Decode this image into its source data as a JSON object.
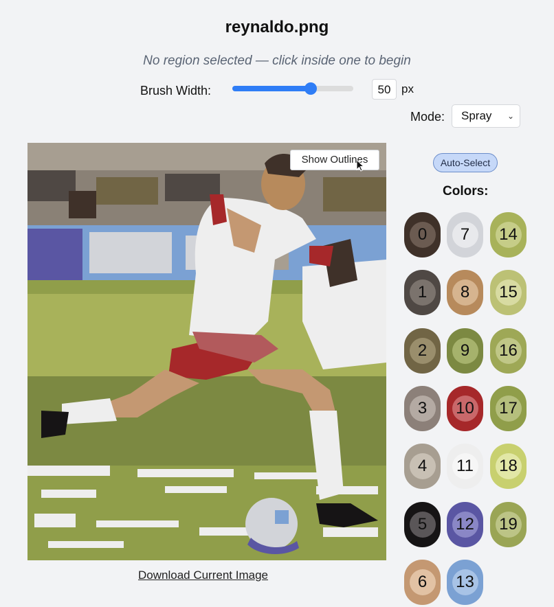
{
  "title": "reynaldo.png",
  "status": "No region selected — click inside one to begin",
  "brush": {
    "label": "Brush Width:",
    "value": "50",
    "unit": "px",
    "fraction": 0.65
  },
  "mode": {
    "label": "Mode:",
    "selected": "Spray"
  },
  "canvas": {
    "show_outlines": "Show Outlines"
  },
  "download_link": "Download Current Image",
  "auto_select": "Auto-Select",
  "colors_label": "Colors:",
  "colors": [
    {
      "n": "0",
      "color": "#3f3129",
      "inner": "#6b5b51"
    },
    {
      "n": "1",
      "color": "#4f4844",
      "inner": "#7b736d"
    },
    {
      "n": "2",
      "color": "#716545",
      "inner": "#9a8e6c"
    },
    {
      "n": "3",
      "color": "#8c8079",
      "inner": "#b4aaa3"
    },
    {
      "n": "4",
      "color": "#a79e91",
      "inner": "#c8c0b4"
    },
    {
      "n": "5",
      "color": "#161415",
      "inner": "#5a5658"
    },
    {
      "n": "6",
      "color": "#c49872",
      "inner": "#e2c2a4"
    },
    {
      "n": "7",
      "color": "#d2d4d9",
      "inner": "#e8e9ec"
    },
    {
      "n": "8",
      "color": "#b78a5c",
      "inner": "#d6b48f"
    },
    {
      "n": "9",
      "color": "#7c8942",
      "inner": "#a6b26c"
    },
    {
      "n": "10",
      "color": "#a6282a",
      "inner": "#c9686a"
    },
    {
      "n": "11",
      "color": "#eeeeee",
      "inner": "#f6f6f6"
    },
    {
      "n": "12",
      "color": "#5a56a3",
      "inner": "#8a87c6"
    },
    {
      "n": "13",
      "color": "#7ba1d3",
      "inner": "#a8c3e6"
    },
    {
      "n": "14",
      "color": "#a8b25a",
      "inner": "#c6cd88"
    },
    {
      "n": "15",
      "color": "#bcc175",
      "inner": "#d8dba2"
    },
    {
      "n": "16",
      "color": "#9ea856",
      "inner": "#c0c787"
    },
    {
      "n": "17",
      "color": "#909e4a",
      "inner": "#b5bf7d"
    },
    {
      "n": "18",
      "color": "#c8d06f",
      "inner": "#e2e7a6"
    },
    {
      "n": "19",
      "color": "#9aa555",
      "inner": "#bcc486"
    }
  ]
}
